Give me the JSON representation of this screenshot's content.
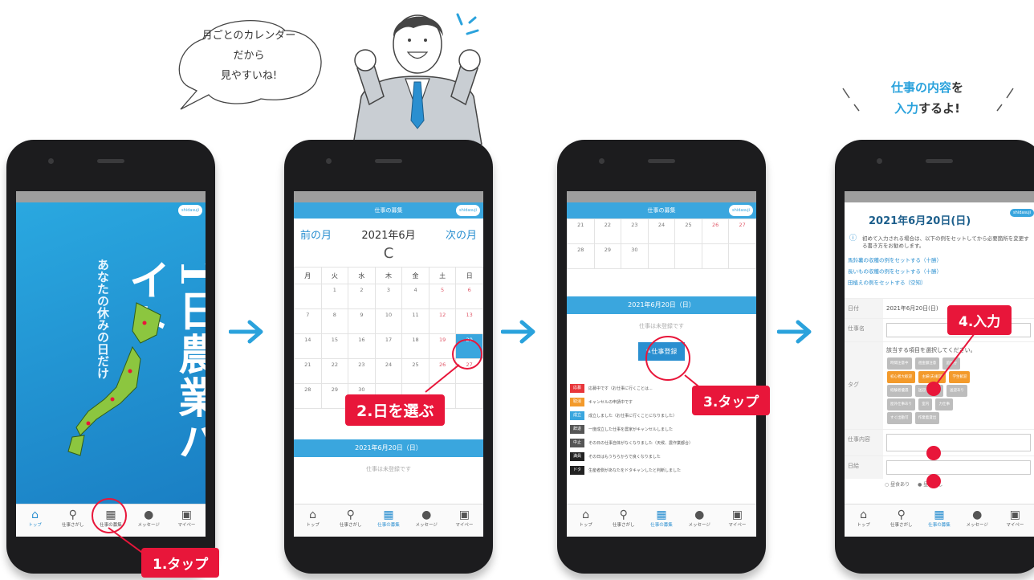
{
  "colors": {
    "accent": "#3aa6de",
    "callout": "#e8163a",
    "arrow": "#2aa2dc"
  },
  "bubble": {
    "line1": "月ごとのカレンダー",
    "line2": "だから",
    "line3": "見やすいね!"
  },
  "speech_right": {
    "line1_a": "仕事の内容",
    "line1_b": "を",
    "line2_a": "入力",
    "line2_b": "するよ!"
  },
  "steps": {
    "s1": "1.タップ",
    "s2": "2.日を選ぶ",
    "s3": "3.タップ",
    "s4": "4.入力"
  },
  "nav": {
    "top": "トップ",
    "search": "仕事さがし",
    "recruit": "仕事の募集",
    "message": "メッセージ",
    "mypage": "マイペー"
  },
  "cover": {
    "big": "1日農業バイト",
    "sub": "あなたの休みの日だけ",
    "user": "shidasuji"
  },
  "calendar": {
    "appbar": "仕事の募集",
    "user": "shidasuji",
    "prev": "前の月",
    "month": "2021年6月",
    "next": "次の月",
    "reload": "C",
    "weekdays": [
      "月",
      "火",
      "水",
      "木",
      "金",
      "土",
      "日"
    ],
    "rows": [
      [
        "",
        "1",
        "2",
        "3",
        "4",
        "5",
        "6"
      ],
      [
        "7",
        "8",
        "9",
        "10",
        "11",
        "12",
        "13"
      ],
      [
        "14",
        "15",
        "16",
        "17",
        "18",
        "19",
        "20"
      ],
      [
        "21",
        "22",
        "23",
        "24",
        "25",
        "26",
        "27"
      ],
      [
        "28",
        "29",
        "30",
        "",
        "",
        "",
        ""
      ]
    ],
    "date": "2021年6月20日（日）",
    "empty": "仕事は未登録です"
  },
  "screen3": {
    "appbar": "仕事の募集",
    "row1": [
      "21",
      "22",
      "23",
      "24",
      "25",
      "26",
      "27"
    ],
    "row2": [
      "28",
      "29",
      "30",
      "",
      "",
      "",
      ""
    ],
    "date": "2021年6月20日（日）",
    "empty": "仕事は未登録です",
    "button": "仕事登録",
    "legend": [
      {
        "badge": "応募",
        "color": "#e8363a",
        "text": "応募中です（お仕事に行くことは..."
      },
      {
        "badge": "取消",
        "color": "#f39a2b",
        "text": "キャンセルの申請中です"
      },
      {
        "badge": "成立",
        "color": "#3aa6de",
        "text": "成立しました（お仕事に行くことになりました）"
      },
      {
        "badge": "辞退",
        "color": "#555555",
        "text": "一度成立した仕事を農家がキャンセルしました"
      },
      {
        "badge": "中止",
        "color": "#555555",
        "text": "その日の仕事自体がなくなりました（天候、農作業都合）"
      },
      {
        "badge": "満員",
        "color": "#222222",
        "text": "その日はもうちらからで良くなりました"
      },
      {
        "badge": "ドタ",
        "color": "#222222",
        "text": "生産者側があなたをドタキャンしたと判断しました"
      }
    ]
  },
  "screen4": {
    "title": "2021年6月20日(日)",
    "user": "shidasuji",
    "info": "初めて入力される場合は、以下の例をセットしてから必要箇所を変更する書き方をお勧めします。",
    "links": [
      "馬鈴薯の収穫の例をセットする（十勝）",
      "長いもの収穫の例をセットする（十勝）",
      "田植えの例をセットする（空知）"
    ],
    "date_label": "日付",
    "date_val": "2021年6月20日(日)",
    "name_label": "仕事名",
    "tag_label": "タグ",
    "tag_hint": "該当する項目を選択してください。",
    "chips": [
      {
        "t": "時間注意中",
        "c": "#bdbdbd"
      },
      {
        "t": "週金額注意",
        "c": "#bdbdbd"
      },
      {
        "t": "追加分",
        "c": "#bdbdbd"
      },
      {
        "t": "初心者大歓迎",
        "c": "#f39a2b"
      },
      {
        "t": "主婦(夫)歓迎",
        "c": "#f39a2b"
      },
      {
        "t": "学生歓迎",
        "c": "#f39a2b"
      },
      {
        "t": "経験者優遇",
        "c": "#bdbdbd"
      },
      {
        "t": "送迎有料送迎",
        "c": "#bdbdbd"
      },
      {
        "t": "送迎あり",
        "c": "#bdbdbd"
      },
      {
        "t": "屋外仕事あり",
        "c": "#bdbdbd"
      },
      {
        "t": "室内",
        "c": "#bdbdbd"
      },
      {
        "t": "力仕事",
        "c": "#bdbdbd"
      },
      {
        "t": "すぐ出勤可",
        "c": "#bdbdbd"
      },
      {
        "t": "作業着貸出",
        "c": "#bdbdbd"
      }
    ],
    "content_label": "仕事内容",
    "wage_label": "日給",
    "radio1": "昼食あり",
    "radio2": "昼食なし"
  }
}
